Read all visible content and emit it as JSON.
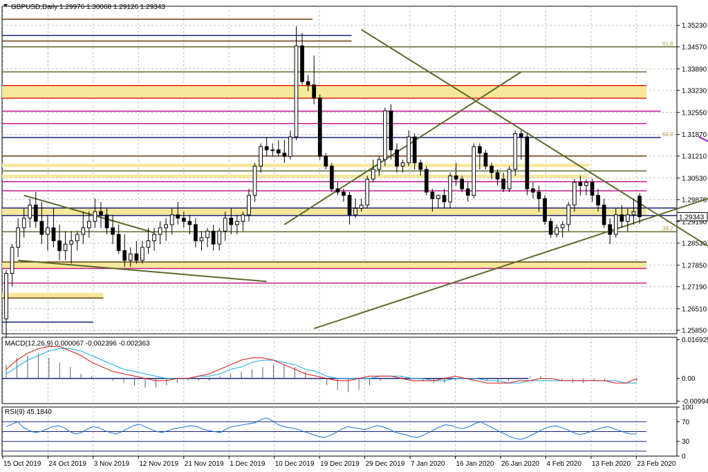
{
  "header": {
    "symbol_line": "GBPUSD,Daily  1.29976 1.30068 1.29126 1.29343"
  },
  "macd": {
    "label": "MACD(12,26,9) 0.000067 -0.002396 -0.002363"
  },
  "rsi": {
    "label": "RSI(9) 45.1840"
  },
  "fib_labels": [
    "61.8",
    "50.0",
    "38.2"
  ],
  "colors": {
    "bull": "#ffffff",
    "bear": "#000000",
    "grid": "#c0c0c0",
    "gold": "#f5e89a",
    "red": "#e8200a",
    "magenta": "#c01890",
    "olive": "#5a6a28",
    "navy": "#18207a",
    "brown": "#6a3a10",
    "violet": "#9018d8",
    "macd_main": "#d81010",
    "macd_signal": "#18a8e8",
    "rsi": "#1070d8"
  },
  "chart_data": [
    {
      "type": "candlestick",
      "name": "GBPUSD Daily",
      "ohlc_last": {
        "open": 1.29976,
        "high": 1.30068,
        "low": 1.29126,
        "close": 1.29343
      },
      "current_price_label": "1.29343",
      "y_ticks": [
        "1.35230",
        "1.34570",
        "1.33890",
        "1.33230",
        "1.32550",
        "1.31870",
        "1.31210",
        "1.30530",
        "1.29870",
        "1.29190",
        "1.28530",
        "1.27850",
        "1.27190",
        "1.26510",
        "1.25850"
      ],
      "ylim": [
        1.2574,
        1.3582
      ],
      "x_labels": [
        "15 Oct 2019",
        "24 Oct 2019",
        "3 Nov 2019",
        "12 Nov 2019",
        "21 Nov 2019",
        "1 Dec 2019",
        "10 Dec 2019",
        "19 Dec 2019",
        "29 Dec 2019",
        "7 Jan 2020",
        "16 Jan 2020",
        "26 Jan 2020",
        "4 Feb 2020",
        "13 Feb 2020",
        "23 Feb 2020"
      ],
      "candles": [
        [
          1.262,
          1.277,
          1.256,
          1.276
        ],
        [
          1.276,
          1.285,
          1.272,
          1.284
        ],
        [
          1.284,
          1.293,
          1.281,
          1.29
        ],
        [
          1.29,
          1.296,
          1.287,
          1.293
        ],
        [
          1.293,
          1.299,
          1.29,
          1.297
        ],
        [
          1.297,
          1.301,
          1.29,
          1.292
        ],
        [
          1.292,
          1.298,
          1.285,
          1.288
        ],
        [
          1.288,
          1.294,
          1.283,
          1.29
        ],
        [
          1.29,
          1.296,
          1.284,
          1.286
        ],
        [
          1.286,
          1.291,
          1.28,
          1.283
        ],
        [
          1.283,
          1.289,
          1.28,
          1.285
        ],
        [
          1.285,
          1.289,
          1.279,
          1.286
        ],
        [
          1.286,
          1.289,
          1.283,
          1.288
        ],
        [
          1.288,
          1.295,
          1.285,
          1.29
        ],
        [
          1.29,
          1.295,
          1.287,
          1.292
        ],
        [
          1.292,
          1.299,
          1.29,
          1.295
        ],
        [
          1.295,
          1.298,
          1.29,
          1.294
        ],
        [
          1.294,
          1.296,
          1.288,
          1.29
        ],
        [
          1.29,
          1.294,
          1.285,
          1.288
        ],
        [
          1.288,
          1.291,
          1.282,
          1.283
        ],
        [
          1.283,
          1.288,
          1.278,
          1.28
        ],
        [
          1.28,
          1.284,
          1.278,
          1.282
        ],
        [
          1.282,
          1.286,
          1.279,
          1.28
        ],
        [
          1.28,
          1.286,
          1.279,
          1.284
        ],
        [
          1.284,
          1.29,
          1.282,
          1.286
        ],
        [
          1.286,
          1.29,
          1.283,
          1.288
        ],
        [
          1.288,
          1.292,
          1.285,
          1.29
        ],
        [
          1.29,
          1.293,
          1.286,
          1.291
        ],
        [
          1.291,
          1.296,
          1.288,
          1.294
        ],
        [
          1.294,
          1.298,
          1.291,
          1.293
        ],
        [
          1.293,
          1.295,
          1.29,
          1.292
        ],
        [
          1.292,
          1.294,
          1.288,
          1.291
        ],
        [
          1.291,
          1.293,
          1.284,
          1.286
        ],
        [
          1.286,
          1.289,
          1.283,
          1.287
        ],
        [
          1.287,
          1.29,
          1.284,
          1.289
        ],
        [
          1.289,
          1.291,
          1.283,
          1.285
        ],
        [
          1.285,
          1.29,
          1.283,
          1.289
        ],
        [
          1.289,
          1.295,
          1.286,
          1.293
        ],
        [
          1.293,
          1.296,
          1.288,
          1.291
        ],
        [
          1.291,
          1.294,
          1.288,
          1.292
        ],
        [
          1.292,
          1.295,
          1.289,
          1.294
        ],
        [
          1.294,
          1.302,
          1.292,
          1.3
        ],
        [
          1.3,
          1.31,
          1.298,
          1.309
        ],
        [
          1.309,
          1.316,
          1.307,
          1.315
        ],
        [
          1.315,
          1.318,
          1.312,
          1.314
        ],
        [
          1.314,
          1.316,
          1.312,
          1.314
        ],
        [
          1.314,
          1.317,
          1.312,
          1.313
        ],
        [
          1.313,
          1.317,
          1.31,
          1.312
        ],
        [
          1.312,
          1.32,
          1.311,
          1.318
        ],
        [
          1.318,
          1.352,
          1.317,
          1.346
        ],
        [
          1.346,
          1.35,
          1.334,
          1.335
        ],
        [
          1.335,
          1.337,
          1.332,
          1.334
        ],
        [
          1.334,
          1.343,
          1.328,
          1.33
        ],
        [
          1.33,
          1.331,
          1.311,
          1.312
        ],
        [
          1.312,
          1.313,
          1.308,
          1.309
        ],
        [
          1.309,
          1.31,
          1.301,
          1.302
        ],
        [
          1.302,
          1.304,
          1.3,
          1.301
        ],
        [
          1.301,
          1.302,
          1.298,
          1.3
        ],
        [
          1.3,
          1.301,
          1.291,
          1.294
        ],
        [
          1.294,
          1.299,
          1.293,
          1.296
        ],
        [
          1.296,
          1.299,
          1.295,
          1.297
        ],
        [
          1.297,
          1.306,
          1.296,
          1.305
        ],
        [
          1.305,
          1.311,
          1.304,
          1.308
        ],
        [
          1.308,
          1.312,
          1.306,
          1.311
        ],
        [
          1.311,
          1.327,
          1.309,
          1.326
        ],
        [
          1.326,
          1.328,
          1.311,
          1.314
        ],
        [
          1.314,
          1.316,
          1.307,
          1.309
        ],
        [
          1.309,
          1.311,
          1.307,
          1.31
        ],
        [
          1.31,
          1.32,
          1.309,
          1.318
        ],
        [
          1.318,
          1.319,
          1.308,
          1.31
        ],
        [
          1.31,
          1.311,
          1.306,
          1.308
        ],
        [
          1.308,
          1.309,
          1.3,
          1.301
        ],
        [
          1.301,
          1.302,
          1.295,
          1.299
        ],
        [
          1.299,
          1.3,
          1.296,
          1.3
        ],
        [
          1.3,
          1.302,
          1.296,
          1.298
        ],
        [
          1.298,
          1.307,
          1.296,
          1.306
        ],
        [
          1.306,
          1.31,
          1.303,
          1.305
        ],
        [
          1.305,
          1.306,
          1.301,
          1.302
        ],
        [
          1.302,
          1.304,
          1.298,
          1.3
        ],
        [
          1.3,
          1.316,
          1.299,
          1.315
        ],
        [
          1.315,
          1.316,
          1.308,
          1.313
        ],
        [
          1.313,
          1.314,
          1.308,
          1.309
        ],
        [
          1.309,
          1.31,
          1.305,
          1.307
        ],
        [
          1.307,
          1.308,
          1.303,
          1.305
        ],
        [
          1.305,
          1.307,
          1.301,
          1.302
        ],
        [
          1.302,
          1.309,
          1.301,
          1.308
        ],
        [
          1.308,
          1.32,
          1.306,
          1.319
        ],
        [
          1.319,
          1.32,
          1.311,
          1.318
        ],
        [
          1.318,
          1.319,
          1.3,
          1.302
        ],
        [
          1.302,
          1.304,
          1.299,
          1.301
        ],
        [
          1.301,
          1.303,
          1.295,
          1.299
        ],
        [
          1.299,
          1.3,
          1.291,
          1.292
        ],
        [
          1.292,
          1.293,
          1.287,
          1.288
        ],
        [
          1.288,
          1.291,
          1.287,
          1.29
        ],
        [
          1.29,
          1.292,
          1.287,
          1.291
        ],
        [
          1.291,
          1.298,
          1.289,
          1.297
        ],
        [
          1.297,
          1.305,
          1.295,
          1.304
        ],
        [
          1.304,
          1.306,
          1.3,
          1.303
        ],
        [
          1.303,
          1.305,
          1.3,
          1.304
        ],
        [
          1.304,
          1.305,
          1.298,
          1.3
        ],
        [
          1.3,
          1.302,
          1.295,
          1.297
        ],
        [
          1.297,
          1.299,
          1.29,
          1.291
        ],
        [
          1.291,
          1.293,
          1.285,
          1.288
        ],
        [
          1.288,
          1.296,
          1.287,
          1.294
        ],
        [
          1.294,
          1.297,
          1.29,
          1.292
        ],
        [
          1.292,
          1.296,
          1.289,
          1.294
        ],
        [
          1.294,
          1.299,
          1.291,
          1.295
        ],
        [
          1.29976,
          1.30068,
          1.29126,
          1.29343
        ]
      ],
      "horizontal_levels": [
        {
          "price": 1.3542,
          "color": "brown",
          "x_end": 0.46
        },
        {
          "price": 1.3492,
          "color": "navy",
          "x_end": 0.518
        },
        {
          "price": 1.3475,
          "color": "brown",
          "x_end": 0.518
        },
        {
          "price": 1.3457,
          "color": "olive",
          "x_end": 1.0
        },
        {
          "price": 1.338,
          "color": "olive",
          "x_end": 0.955
        },
        {
          "price": 1.3338,
          "color": "red",
          "x_end": 0.955
        },
        {
          "price": 1.3299,
          "color": "red",
          "x_end": 0.955
        },
        {
          "price": 1.3259,
          "color": "magenta",
          "x_end": 0.976
        },
        {
          "price": 1.3221,
          "color": "magenta",
          "x_end": 0.955
        },
        {
          "price": 1.3178,
          "color": "navy",
          "x_end": 0.976
        },
        {
          "price": 1.3121,
          "color": "brown",
          "x_end": 0.955
        },
        {
          "price": 1.3075,
          "color": "olive",
          "x_end": 0.955
        },
        {
          "price": 1.3042,
          "color": "magenta",
          "x_end": 0.955
        },
        {
          "price": 1.3014,
          "color": "magenta",
          "x_end": 0.955
        },
        {
          "price": 1.2961,
          "color": "navy",
          "x_end": 1.0
        },
        {
          "price": 1.2938,
          "color": "navy",
          "x_end": 1.0
        },
        {
          "price": 1.2888,
          "color": "olive",
          "x_end": 1.0
        },
        {
          "price": 1.2795,
          "color": "brown",
          "x_end": 0.955
        },
        {
          "price": 1.2775,
          "color": "magenta",
          "x_end": 0.955
        },
        {
          "price": 1.273,
          "color": "magenta",
          "x_end": 0.955
        },
        {
          "price": 1.2684,
          "color": "brown",
          "x_end": 0.15
        },
        {
          "price": 1.261,
          "color": "navy",
          "x_end": 0.135
        }
      ],
      "zones": [
        {
          "top": 1.3338,
          "bottom": 1.3299,
          "x_end": 0.955
        },
        {
          "top": 1.3097,
          "bottom": 1.3087,
          "x_end": 0.87
        },
        {
          "top": 1.3064,
          "bottom": 1.3054,
          "x_end": 0.87
        },
        {
          "top": 1.2961,
          "bottom": 1.2938,
          "x_end": 0.955
        },
        {
          "top": 1.2795,
          "bottom": 1.2775,
          "x_end": 0.955
        },
        {
          "top": 1.27,
          "bottom": 1.2684,
          "x_end": 0.15
        }
      ],
      "trendlines": [
        {
          "from": [
            3,
            1.3
          ],
          "to": [
            25,
            1.2885
          ],
          "color": "olive"
        },
        {
          "from": [
            2,
            1.28
          ],
          "to": [
            44,
            1.2735
          ],
          "color": "olive"
        },
        {
          "from": [
            52,
            1.259
          ],
          "to": [
            141,
            1.3125
          ],
          "color": "olive"
        },
        {
          "from": [
            47,
            1.291
          ],
          "to": [
            87,
            1.338
          ],
          "color": "olive"
        },
        {
          "from": [
            60,
            1.351
          ],
          "to": [
            122,
            1.2805
          ],
          "color": "olive"
        },
        {
          "from": [
            117,
            1.318
          ],
          "to": [
            146,
            1.293
          ],
          "color": "violet"
        }
      ]
    },
    {
      "type": "bar+line",
      "name": "MACD(12,26,9)",
      "values_shown": {
        "main": 6.7e-05,
        "signal": -0.002396,
        "hist": -0.002363
      },
      "y_ticks": [
        "0.016925",
        "0.00",
        "-0.009949"
      ],
      "ylim": [
        -0.011,
        0.018
      ],
      "histogram": [
        0.006,
        0.009,
        0.01,
        0.011,
        0.009,
        0.007,
        0.005,
        0.002,
        0.001,
        0.0,
        -0.001,
        -0.002,
        -0.003,
        -0.004,
        -0.004,
        -0.003,
        -0.002,
        -0.001,
        -0.001,
        -0.001,
        0.001,
        0.002,
        0.003,
        0.004,
        0.005,
        0.006,
        0.006,
        0.005,
        0.003,
        0.0,
        -0.003,
        -0.005,
        -0.006,
        -0.005,
        -0.003,
        -0.001,
        0.0,
        0.001,
        0.0,
        -0.001,
        -0.002,
        -0.002,
        -0.001,
        0.0,
        0.0,
        -0.001,
        -0.002,
        -0.001,
        0.0,
        0.001,
        0.001,
        0.0,
        -0.001,
        -0.002,
        -0.002,
        -0.001,
        -0.001,
        0.0,
        0.0,
        -0.001
      ],
      "main": [
        0.004,
        0.008,
        0.011,
        0.013,
        0.014,
        0.014,
        0.012,
        0.01,
        0.007,
        0.005,
        0.003,
        0.002,
        0.001,
        0.0,
        -0.001,
        -0.001,
        0.0,
        0.0,
        0.001,
        0.002,
        0.004,
        0.006,
        0.008,
        0.009,
        0.009,
        0.008,
        0.006,
        0.004,
        0.002,
        0.001,
        0.0,
        -0.001,
        -0.001,
        0.0,
        0.001,
        0.001,
        0.001,
        0.0,
        -0.001,
        -0.001,
        -0.001,
        0.0,
        0.001,
        0.0,
        -0.001,
        -0.002,
        -0.002,
        -0.002,
        -0.001,
        -0.001,
        0.0,
        0.0,
        -0.001,
        -0.001,
        -0.001,
        -0.001,
        -0.001,
        -0.002,
        -0.002,
        0.0
      ],
      "signal": [
        0.002,
        0.005,
        0.008,
        0.01,
        0.012,
        0.013,
        0.013,
        0.012,
        0.01,
        0.008,
        0.006,
        0.004,
        0.003,
        0.002,
        0.001,
        0.0,
        0.0,
        0.0,
        0.001,
        0.001,
        0.002,
        0.004,
        0.005,
        0.007,
        0.008,
        0.008,
        0.007,
        0.006,
        0.004,
        0.003,
        0.001,
        0.0,
        0.0,
        0.0,
        0.0,
        0.001,
        0.001,
        0.001,
        0.0,
        0.0,
        -0.001,
        -0.001,
        0.0,
        0.0,
        0.0,
        -0.001,
        -0.001,
        -0.002,
        -0.002,
        -0.001,
        -0.001,
        -0.001,
        -0.001,
        -0.001,
        -0.001,
        -0.001,
        -0.001,
        -0.001,
        -0.002,
        -0.002
      ],
      "level": {
        "value": 0.0,
        "x_end": 0.78
      }
    },
    {
      "type": "line",
      "name": "RSI(9)",
      "value_shown": 45.184,
      "y_ticks": [
        "100",
        "70",
        "30",
        "0"
      ],
      "ylim": [
        0,
        100
      ],
      "levels": [
        70,
        50,
        30,
        10
      ],
      "values": [
        60,
        65,
        70,
        58,
        52,
        48,
        50,
        55,
        60,
        62,
        58,
        50,
        45,
        48,
        55,
        60,
        58,
        52,
        48,
        45,
        50,
        56,
        62,
        65,
        60,
        55,
        50,
        48,
        52,
        56,
        58,
        60,
        62,
        60,
        55,
        52,
        50,
        48,
        55,
        60,
        62,
        64,
        66,
        68,
        74,
        78,
        72,
        64,
        60,
        58,
        56,
        52,
        48,
        44,
        40,
        38,
        42,
        48,
        55,
        60,
        58,
        56,
        54,
        58,
        62,
        60,
        56,
        50,
        46,
        44,
        40,
        38,
        42,
        48,
        54,
        60,
        64,
        62,
        58,
        56,
        60,
        66,
        70,
        64,
        58,
        52,
        46,
        40,
        36,
        34,
        38,
        44,
        50,
        56,
        60,
        62,
        58,
        54,
        48,
        44,
        46,
        50,
        54,
        58,
        60,
        56,
        52,
        48,
        45,
        45
      ]
    }
  ]
}
